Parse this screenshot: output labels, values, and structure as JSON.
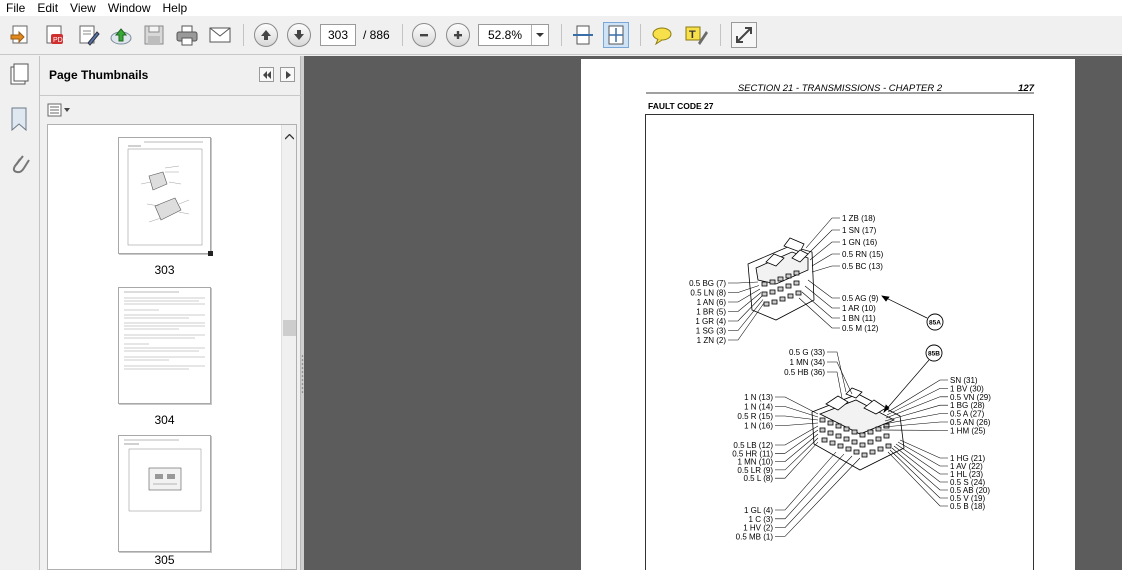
{
  "menu": [
    "File",
    "Edit",
    "View",
    "Window",
    "Help"
  ],
  "toolbar": {
    "current_page": "303",
    "total_pages": "/ 886",
    "zoom": "52.8%"
  },
  "panel": {
    "title": "Page Thumbnails",
    "thumbnails": [
      {
        "label": "303"
      },
      {
        "label": "304"
      },
      {
        "label": "305"
      }
    ]
  },
  "doc": {
    "header": "SECTION 21 - TRANSMISSIONS - CHAPTER 2",
    "page_number": "127",
    "fault_code": "FAULT CODE 27",
    "conn_a": {
      "badge": "85A",
      "left": [
        "0.5 BG (7)",
        "0.5 LN (8)",
        "1 AN (6)",
        "1 BR (5)",
        "1 GR (4)",
        "1 SG (3)",
        "1 ZN (2)"
      ],
      "right_top": [
        "1 ZB (18)",
        "1 SN (17)",
        "1 GN (16)",
        "0.5 RN (15)",
        "0.5 BC (13)"
      ],
      "right_mid": [
        "0.5 AG (9)",
        "1 AR (10)",
        "1 BN (11)",
        "0.5 M (12)"
      ]
    },
    "conn_b": {
      "badge": "85B",
      "top": [
        "0.5 G (33)",
        "1 MN (34)",
        "0.5 HB (36)"
      ],
      "left1": [
        "1 N (13)",
        "1 N (14)",
        "0.5 R (15)",
        "1 N (16)"
      ],
      "left2": [
        "0.5 LB (12)",
        "0.5 HR (11)",
        "1 MN (10)",
        "0.5 LR (9)",
        "0.5 L (8)"
      ],
      "left3": [
        "1 GL (4)",
        "1 C (3)",
        "1 HV (2)",
        "0.5 MB (1)"
      ],
      "right1": [
        "SN (31)",
        "1 BV (30)",
        "0.5 VN (29)",
        "1 BG (28)",
        "0.5 A (27)",
        "0.5 AN (26)",
        "1 HM (25)"
      ],
      "right2": [
        "1 HG (21)",
        "1 AV (22)",
        "1 HL (23)",
        "0.5 S (24)",
        "0.5 AB (20)",
        "0.5 V (19)",
        "0.5 B (18)"
      ]
    }
  }
}
